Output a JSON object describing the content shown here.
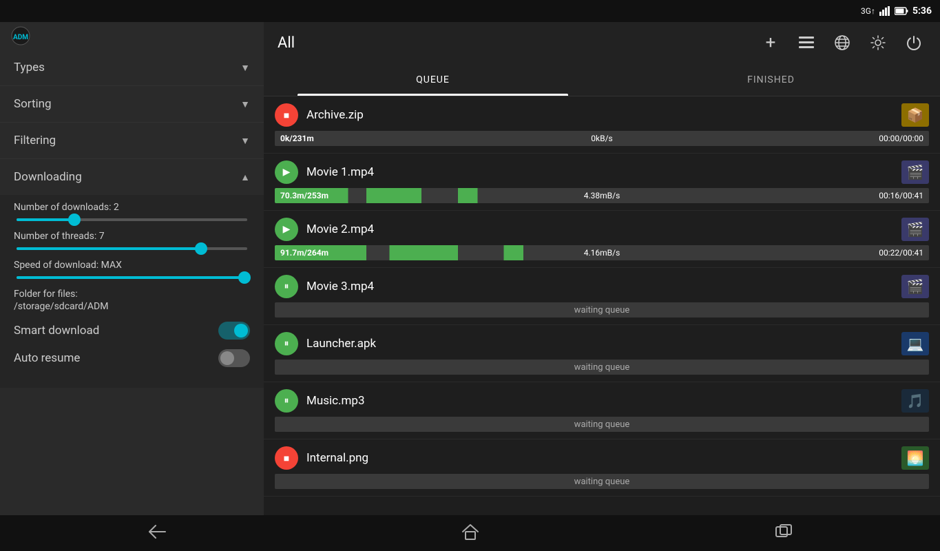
{
  "statusBar": {
    "signal": "3G",
    "battery": "🔋",
    "time": "5:36"
  },
  "sidebar": {
    "items": [
      {
        "label": "Types",
        "icon": "chevron-down",
        "expanded": false
      },
      {
        "label": "Sorting",
        "icon": "chevron-down",
        "expanded": false
      },
      {
        "label": "Filtering",
        "icon": "chevron-down",
        "expanded": false
      },
      {
        "label": "Downloading",
        "icon": "chevron-up",
        "expanded": true
      }
    ],
    "downloading": {
      "numDownloads": {
        "label": "Number of downloads: 2",
        "value": 2,
        "percent": 25
      },
      "numThreads": {
        "label": "Number of threads: 7",
        "value": 7,
        "percent": 90
      },
      "speed": {
        "label": "Speed of download: MAX",
        "percent": 100
      },
      "folder": {
        "label": "Folder for files:",
        "path": "/storage/sdcard/ADM"
      },
      "smartDownload": {
        "label": "Smart download",
        "enabled": true
      },
      "autoResume": {
        "label": "Auto resume",
        "enabled": false
      }
    }
  },
  "header": {
    "title": "All",
    "icons": [
      "plus",
      "list",
      "globe",
      "gear",
      "power"
    ]
  },
  "tabs": [
    {
      "label": "QUEUE",
      "active": true
    },
    {
      "label": "FINISHED",
      "active": false
    }
  ],
  "downloads": [
    {
      "name": "Archive.zip",
      "status": "stopped",
      "thumb": "zip",
      "progressLeft": "0k/231m",
      "progressMid": "0kB/s",
      "progressRight": "00:00/00:00",
      "progressPercent": 0,
      "hasProgress": true,
      "waiting": false
    },
    {
      "name": "Movie 1.mp4",
      "status": "playing",
      "thumb": "video",
      "progressLeft": "70.3m/253m",
      "progressMid": "4.38mB/s",
      "progressRight": "00:16/00:41",
      "progressPercent": 28,
      "hasProgress": true,
      "waiting": false
    },
    {
      "name": "Movie 2.mp4",
      "status": "playing",
      "thumb": "video",
      "progressLeft": "91.7m/264m",
      "progressMid": "4.16mB/s",
      "progressRight": "00:22/00:41",
      "progressPercent": 35,
      "hasProgress": true,
      "waiting": false
    },
    {
      "name": "Movie 3.mp4",
      "status": "paused",
      "thumb": "video",
      "waitingText": "waiting queue",
      "hasProgress": false,
      "waiting": true
    },
    {
      "name": "Launcher.apk",
      "status": "paused",
      "thumb": "apk",
      "waitingText": "waiting queue",
      "hasProgress": false,
      "waiting": true
    },
    {
      "name": "Music.mp3",
      "status": "paused",
      "thumb": "music",
      "waitingText": "waiting queue",
      "hasProgress": false,
      "waiting": true
    },
    {
      "name": "Internal.png",
      "status": "stopped",
      "thumb": "image",
      "waitingText": "waiting queue",
      "hasProgress": false,
      "waiting": true
    }
  ],
  "bottomNav": {
    "back": "←",
    "home": "⌂",
    "recent": "▭"
  }
}
